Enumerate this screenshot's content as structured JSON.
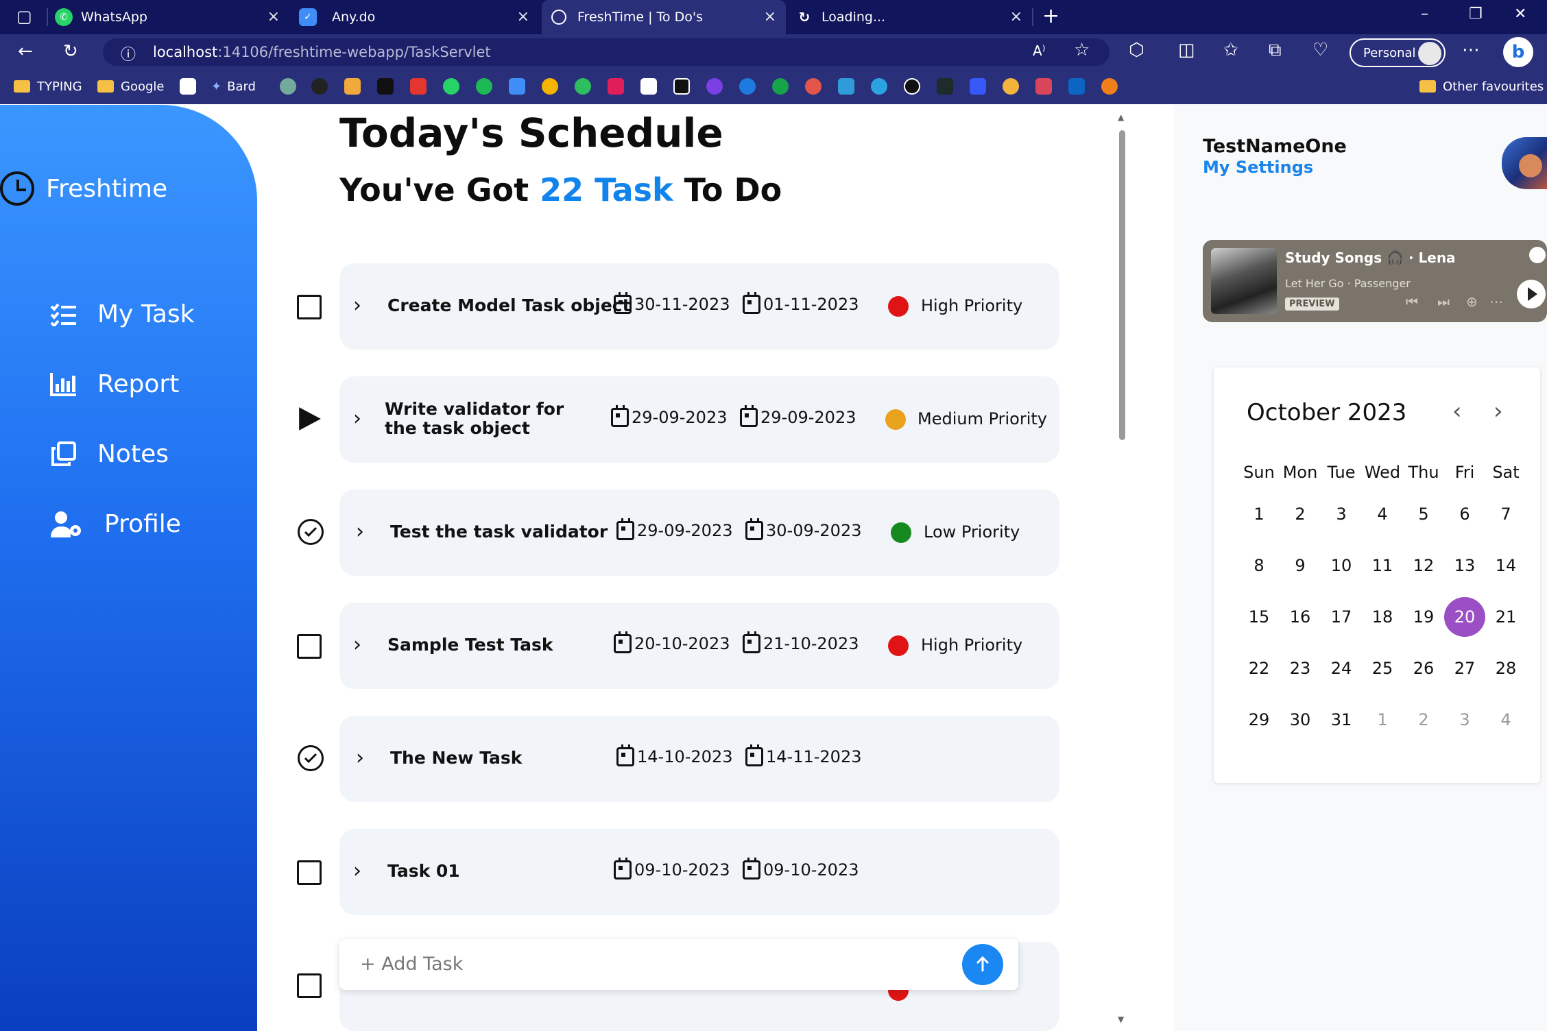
{
  "browser": {
    "tabs": [
      {
        "title": "WhatsApp",
        "active": false
      },
      {
        "title": "Any.do",
        "active": false
      },
      {
        "title": "FreshTime | To Do's",
        "active": true
      },
      {
        "title": "Loading...",
        "active": false
      }
    ],
    "url_host": "localhost",
    "url_rest": ":14106/freshtime-webapp/TaskServlet",
    "profile_label": "Personal",
    "bookmarks": [
      {
        "label": "TYPING"
      },
      {
        "label": "Google"
      },
      {
        "label": "Bard"
      }
    ],
    "other_favourites": "Other favourites"
  },
  "sidebar": {
    "brand": "Freshtime",
    "items": [
      {
        "label": "My Task",
        "icon": "task-list-icon"
      },
      {
        "label": "Report",
        "icon": "bar-chart-icon"
      },
      {
        "label": "Notes",
        "icon": "notes-icon"
      },
      {
        "label": "Profile",
        "icon": "user-gear-icon"
      }
    ]
  },
  "main": {
    "title": "Today's Schedule",
    "sub_prefix": "You've Got ",
    "task_count": "22 Task",
    "sub_suffix": " To Do",
    "tasks": [
      {
        "name": "Create Model Task object",
        "start": "30-11-2023",
        "end": "01-11-2023",
        "priority": "High Priority",
        "status": "checkbox"
      },
      {
        "name": "Write validator for the task object",
        "start": "29-09-2023",
        "end": "29-09-2023",
        "priority": "Medium Priority",
        "status": "play"
      },
      {
        "name": "Test the task validator",
        "start": "29-09-2023",
        "end": "30-09-2023",
        "priority": "Low Priority",
        "status": "done"
      },
      {
        "name": "Sample Test Task",
        "start": "20-10-2023",
        "end": "21-10-2023",
        "priority": "High Priority",
        "status": "checkbox"
      },
      {
        "name": "The New Task",
        "start": "14-10-2023",
        "end": "14-11-2023",
        "priority": "",
        "status": "done"
      },
      {
        "name": "Task 01",
        "start": "09-10-2023",
        "end": "09-10-2023",
        "priority": "",
        "status": "checkbox"
      }
    ],
    "add_task_placeholder": "+ Add Task"
  },
  "colors": {
    "high": "#e01414",
    "medium": "#e8a21c",
    "low": "#178a1f",
    "accent": "#1183ec",
    "today": "#9b4fc4"
  },
  "right": {
    "user_name": "TestNameOne",
    "settings_label": "My Settings",
    "spotify": {
      "title": "Study Songs 🎧 · Lena",
      "sub": "Let Her Go · Passenger",
      "badge": "PREVIEW"
    },
    "calendar": {
      "month": "October 2023",
      "weekdays": [
        "Sun",
        "Mon",
        "Tue",
        "Wed",
        "Thu",
        "Fri",
        "Sat"
      ],
      "weeks": [
        [
          "1",
          "2",
          "3",
          "4",
          "5",
          "6",
          "7"
        ],
        [
          "8",
          "9",
          "10",
          "11",
          "12",
          "13",
          "14"
        ],
        [
          "15",
          "16",
          "17",
          "18",
          "19",
          "20",
          "21"
        ],
        [
          "22",
          "23",
          "24",
          "25",
          "26",
          "27",
          "28"
        ],
        [
          "29",
          "30",
          "31",
          "1",
          "2",
          "3",
          "4"
        ]
      ],
      "today": "20"
    }
  }
}
